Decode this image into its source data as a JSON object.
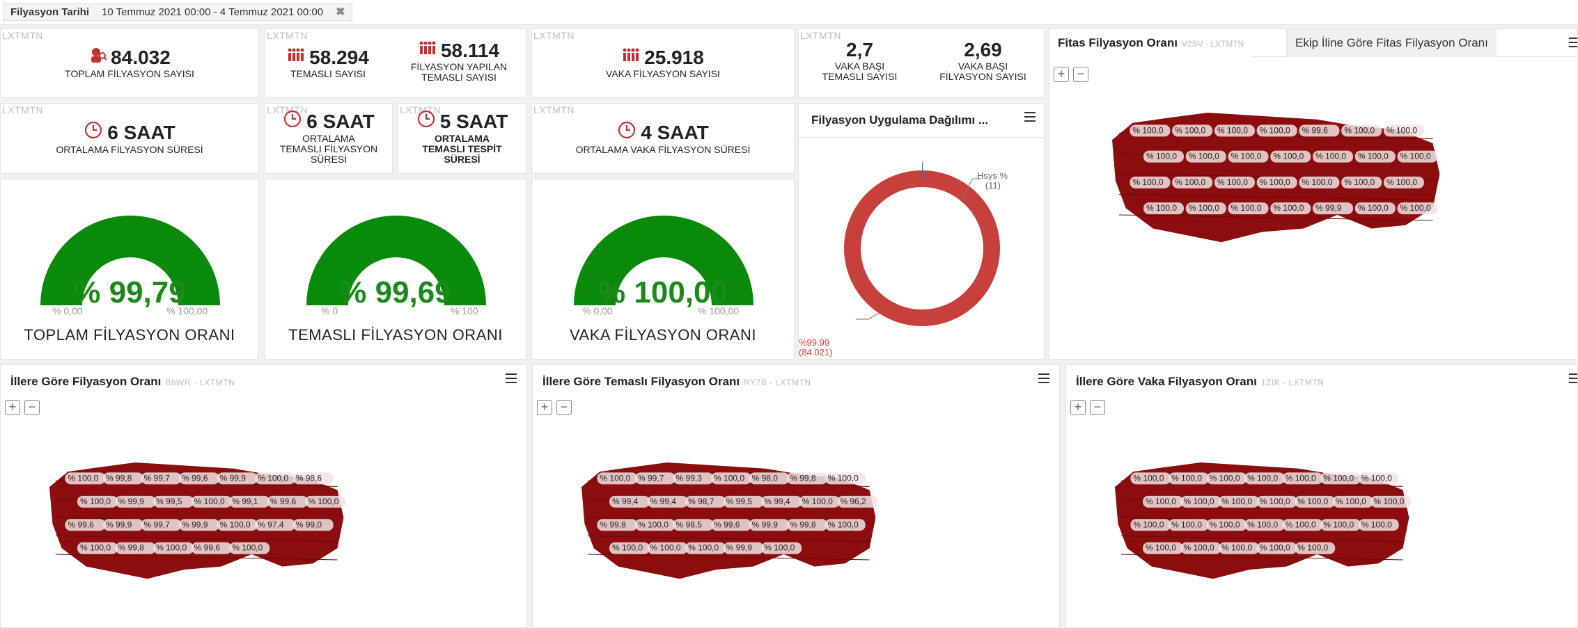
{
  "filter": {
    "label": "Filyasyon Tarihi",
    "value": "10 Temmuz 2021 00:00 - 4 Temmuz 2021 00:00"
  },
  "watermark": "LXTMTN",
  "kpis": {
    "total": {
      "value": "84.032",
      "label": "TOPLAM FİLYASYON SAYISI"
    },
    "contact": {
      "value": "58.294",
      "label": "TEMASLI SAYISI"
    },
    "contact_done": {
      "value": "58.114",
      "label1": "FİLYASYON YAPILAN",
      "label2": "TEMASLI SAYISI"
    },
    "case": {
      "value": "25.918",
      "label": "VAKA FİLYASYON SAYISI"
    },
    "per_case": {
      "value": "2,7",
      "label1": "VAKA BAŞI",
      "label2": "TEMASLI SAYISI"
    },
    "per_case_fil": {
      "value": "2,69",
      "label1": "VAKA BAŞI",
      "label2": "FİLYASYON SAYISI"
    },
    "avg_time": {
      "value": "6 SAAT",
      "label": "ORTALAMA FİLYASYON SÜRESİ"
    },
    "avg_contact_time": {
      "value": "6 SAAT",
      "label1": "ORTALAMA",
      "label2": "TEMASLI FİLYASYON",
      "label3": "SÜRESİ"
    },
    "avg_detect_time": {
      "value": "5 SAAT",
      "label1": "ORTALAMA",
      "label2": "TEMASLI TESPİT",
      "label3": "SÜRESİ"
    },
    "avg_case_time": {
      "value": "4 SAAT",
      "label": "ORTALAMA VAKA FİLYASYON SÜRESİ"
    }
  },
  "gauges": [
    {
      "value_text": "% 99,79",
      "value": 99.79,
      "min": "% 0,00",
      "max": "% 100,00",
      "title": "TOPLAM FİLYASYON ORANI"
    },
    {
      "value_text": "% 99,69",
      "value": 99.69,
      "min": "% 0",
      "max": "% 100",
      "title": "TEMASLI FİLYASYON ORANI"
    },
    {
      "value_text": "% 100,00",
      "value": 100.0,
      "min": "% 0,00",
      "max": "% 100,00",
      "title": "VAKA FİLYASYON ORANI"
    }
  ],
  "donut": {
    "title": "Filyasyon Uygulama Dağılımı ...",
    "label_small": "Hsys %",
    "label_small_count": "(11)",
    "label_big": "%99.99",
    "label_big_count": "(84.021)",
    "colors": {
      "main": "#c8403c",
      "small": "#3a6fb0"
    }
  },
  "map_top": {
    "tab_active": "Fitas Filyasyon Oranı",
    "tab_active_code": "V2SV - LXTMTN",
    "tab_inactive": "Ekip İline Göre Fitas Filyasyon Oranı"
  },
  "map_panels": [
    {
      "title": "İllere Göre Filyasyon Oranı",
      "code": "B8WR - LXTMTN"
    },
    {
      "title": "İllere Göre Temaslı Filyasyon Oranı",
      "code": "RY7B - LXTMTN"
    },
    {
      "title": "İllere Göre Vaka Filyasyon Oranı",
      "code": "1ZIK - LXTMTN"
    }
  ],
  "map_labels": {
    "top": [
      "% 100,0",
      "% 100,0",
      "% 100,0",
      "% 100,0",
      "% 99,6",
      "% 100,0",
      "% 100,0",
      "% 100,0",
      "% 100,0",
      "% 100,0",
      "% 100,0",
      "% 100,0",
      "% 100,0",
      "% 100,0",
      "% 100,0",
      "% 100,0",
      "% 100,0",
      "% 100,0",
      "% 100,0",
      "% 100,0",
      "% 100,0",
      "% 100,0",
      "% 100,0",
      "% 100,0",
      "% 100,0",
      "% 99,9",
      "% 100,0",
      "% 100,0"
    ],
    "left": [
      "% 100,0",
      "% 99,8",
      "% 99,7",
      "% 99,6",
      "% 99,9",
      "% 100,0",
      "% 98,6",
      "% 100,0",
      "% 99,9",
      "% 99,5",
      "% 100,0",
      "% 99,1",
      "% 99,6",
      "% 100,0",
      "% 99,6",
      "% 99,9",
      "% 99,7",
      "% 99,9",
      "% 100,0",
      "% 97,4",
      "% 99,0",
      "% 100,0",
      "% 99,8",
      "% 100,0",
      "% 99,6",
      "% 100,0"
    ],
    "middle": [
      "% 100,0",
      "% 99,7",
      "% 99,3",
      "% 100,0",
      "% 98,0",
      "% 99,8",
      "% 100,0",
      "% 99,4",
      "% 99,4",
      "% 98,7",
      "% 99,5",
      "% 99,4",
      "% 100,0",
      "% 96,2",
      "% 99,8",
      "% 100,0",
      "% 98,5",
      "% 99,6",
      "% 99,9",
      "% 99,8",
      "% 100,0",
      "% 100,0",
      "% 100,0",
      "% 100,0",
      "% 99,9",
      "% 100,0"
    ],
    "right": [
      "% 100,0",
      "% 100,0",
      "% 100,0",
      "% 100,0",
      "% 100,0",
      "% 100,0",
      "% 100,0",
      "% 100,0",
      "% 100,0",
      "% 100,0",
      "% 100,0",
      "% 100,0",
      "% 100,0",
      "% 100,0",
      "% 100,0",
      "% 100,0",
      "% 100,0",
      "% 100,0",
      "% 100,0",
      "% 100,0",
      "% 100,0",
      "% 100,0",
      "% 100,0",
      "% 100,0",
      "% 100,0",
      "% 100,0"
    ]
  },
  "colors": {
    "gauge": "#0a8a0a",
    "map": "#8b0d0d",
    "label_bg": "#f1e4e4"
  },
  "icons": {
    "fil": "people-search-icon",
    "contact": "people-group-icon",
    "clock": "clock-icon"
  }
}
